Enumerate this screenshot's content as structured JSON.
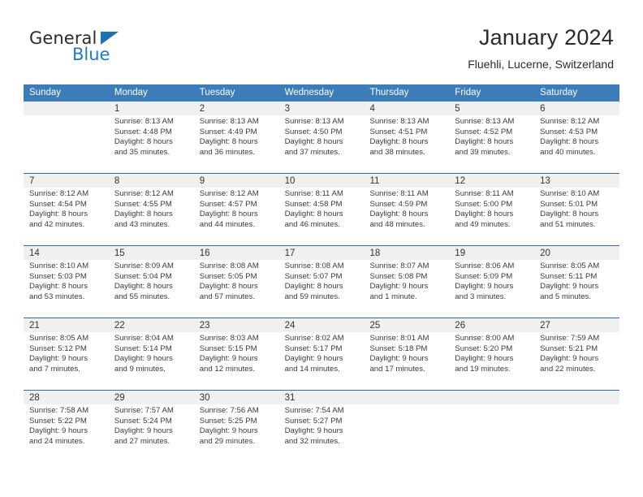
{
  "brand": {
    "name_top": "General",
    "name_bottom": "Blue",
    "color_text": "#2b2b2b",
    "color_blue": "#1e7bc4"
  },
  "header": {
    "title": "January 2024",
    "subtitle": "Fluehli, Lucerne, Switzerland"
  },
  "theme": {
    "header_blue": "#3b7cb9",
    "separator_blue": "#2b6da8",
    "daynum_band": "#f0f0f0"
  },
  "weekdays": [
    "Sunday",
    "Monday",
    "Tuesday",
    "Wednesday",
    "Thursday",
    "Friday",
    "Saturday"
  ],
  "weeks": [
    [
      {
        "day": ""
      },
      {
        "day": "1",
        "sunrise": "Sunrise: 8:13 AM",
        "sunset": "Sunset: 4:48 PM",
        "daylight1": "Daylight: 8 hours",
        "daylight2": "and 35 minutes."
      },
      {
        "day": "2",
        "sunrise": "Sunrise: 8:13 AM",
        "sunset": "Sunset: 4:49 PM",
        "daylight1": "Daylight: 8 hours",
        "daylight2": "and 36 minutes."
      },
      {
        "day": "3",
        "sunrise": "Sunrise: 8:13 AM",
        "sunset": "Sunset: 4:50 PM",
        "daylight1": "Daylight: 8 hours",
        "daylight2": "and 37 minutes."
      },
      {
        "day": "4",
        "sunrise": "Sunrise: 8:13 AM",
        "sunset": "Sunset: 4:51 PM",
        "daylight1": "Daylight: 8 hours",
        "daylight2": "and 38 minutes."
      },
      {
        "day": "5",
        "sunrise": "Sunrise: 8:13 AM",
        "sunset": "Sunset: 4:52 PM",
        "daylight1": "Daylight: 8 hours",
        "daylight2": "and 39 minutes."
      },
      {
        "day": "6",
        "sunrise": "Sunrise: 8:12 AM",
        "sunset": "Sunset: 4:53 PM",
        "daylight1": "Daylight: 8 hours",
        "daylight2": "and 40 minutes."
      }
    ],
    [
      {
        "day": "7",
        "sunrise": "Sunrise: 8:12 AM",
        "sunset": "Sunset: 4:54 PM",
        "daylight1": "Daylight: 8 hours",
        "daylight2": "and 42 minutes."
      },
      {
        "day": "8",
        "sunrise": "Sunrise: 8:12 AM",
        "sunset": "Sunset: 4:55 PM",
        "daylight1": "Daylight: 8 hours",
        "daylight2": "and 43 minutes."
      },
      {
        "day": "9",
        "sunrise": "Sunrise: 8:12 AM",
        "sunset": "Sunset: 4:57 PM",
        "daylight1": "Daylight: 8 hours",
        "daylight2": "and 44 minutes."
      },
      {
        "day": "10",
        "sunrise": "Sunrise: 8:11 AM",
        "sunset": "Sunset: 4:58 PM",
        "daylight1": "Daylight: 8 hours",
        "daylight2": "and 46 minutes."
      },
      {
        "day": "11",
        "sunrise": "Sunrise: 8:11 AM",
        "sunset": "Sunset: 4:59 PM",
        "daylight1": "Daylight: 8 hours",
        "daylight2": "and 48 minutes."
      },
      {
        "day": "12",
        "sunrise": "Sunrise: 8:11 AM",
        "sunset": "Sunset: 5:00 PM",
        "daylight1": "Daylight: 8 hours",
        "daylight2": "and 49 minutes."
      },
      {
        "day": "13",
        "sunrise": "Sunrise: 8:10 AM",
        "sunset": "Sunset: 5:01 PM",
        "daylight1": "Daylight: 8 hours",
        "daylight2": "and 51 minutes."
      }
    ],
    [
      {
        "day": "14",
        "sunrise": "Sunrise: 8:10 AM",
        "sunset": "Sunset: 5:03 PM",
        "daylight1": "Daylight: 8 hours",
        "daylight2": "and 53 minutes."
      },
      {
        "day": "15",
        "sunrise": "Sunrise: 8:09 AM",
        "sunset": "Sunset: 5:04 PM",
        "daylight1": "Daylight: 8 hours",
        "daylight2": "and 55 minutes."
      },
      {
        "day": "16",
        "sunrise": "Sunrise: 8:08 AM",
        "sunset": "Sunset: 5:05 PM",
        "daylight1": "Daylight: 8 hours",
        "daylight2": "and 57 minutes."
      },
      {
        "day": "17",
        "sunrise": "Sunrise: 8:08 AM",
        "sunset": "Sunset: 5:07 PM",
        "daylight1": "Daylight: 8 hours",
        "daylight2": "and 59 minutes."
      },
      {
        "day": "18",
        "sunrise": "Sunrise: 8:07 AM",
        "sunset": "Sunset: 5:08 PM",
        "daylight1": "Daylight: 9 hours",
        "daylight2": "and 1 minute."
      },
      {
        "day": "19",
        "sunrise": "Sunrise: 8:06 AM",
        "sunset": "Sunset: 5:09 PM",
        "daylight1": "Daylight: 9 hours",
        "daylight2": "and 3 minutes."
      },
      {
        "day": "20",
        "sunrise": "Sunrise: 8:05 AM",
        "sunset": "Sunset: 5:11 PM",
        "daylight1": "Daylight: 9 hours",
        "daylight2": "and 5 minutes."
      }
    ],
    [
      {
        "day": "21",
        "sunrise": "Sunrise: 8:05 AM",
        "sunset": "Sunset: 5:12 PM",
        "daylight1": "Daylight: 9 hours",
        "daylight2": "and 7 minutes."
      },
      {
        "day": "22",
        "sunrise": "Sunrise: 8:04 AM",
        "sunset": "Sunset: 5:14 PM",
        "daylight1": "Daylight: 9 hours",
        "daylight2": "and 9 minutes."
      },
      {
        "day": "23",
        "sunrise": "Sunrise: 8:03 AM",
        "sunset": "Sunset: 5:15 PM",
        "daylight1": "Daylight: 9 hours",
        "daylight2": "and 12 minutes."
      },
      {
        "day": "24",
        "sunrise": "Sunrise: 8:02 AM",
        "sunset": "Sunset: 5:17 PM",
        "daylight1": "Daylight: 9 hours",
        "daylight2": "and 14 minutes."
      },
      {
        "day": "25",
        "sunrise": "Sunrise: 8:01 AM",
        "sunset": "Sunset: 5:18 PM",
        "daylight1": "Daylight: 9 hours",
        "daylight2": "and 17 minutes."
      },
      {
        "day": "26",
        "sunrise": "Sunrise: 8:00 AM",
        "sunset": "Sunset: 5:20 PM",
        "daylight1": "Daylight: 9 hours",
        "daylight2": "and 19 minutes."
      },
      {
        "day": "27",
        "sunrise": "Sunrise: 7:59 AM",
        "sunset": "Sunset: 5:21 PM",
        "daylight1": "Daylight: 9 hours",
        "daylight2": "and 22 minutes."
      }
    ],
    [
      {
        "day": "28",
        "sunrise": "Sunrise: 7:58 AM",
        "sunset": "Sunset: 5:22 PM",
        "daylight1": "Daylight: 9 hours",
        "daylight2": "and 24 minutes."
      },
      {
        "day": "29",
        "sunrise": "Sunrise: 7:57 AM",
        "sunset": "Sunset: 5:24 PM",
        "daylight1": "Daylight: 9 hours",
        "daylight2": "and 27 minutes."
      },
      {
        "day": "30",
        "sunrise": "Sunrise: 7:56 AM",
        "sunset": "Sunset: 5:25 PM",
        "daylight1": "Daylight: 9 hours",
        "daylight2": "and 29 minutes."
      },
      {
        "day": "31",
        "sunrise": "Sunrise: 7:54 AM",
        "sunset": "Sunset: 5:27 PM",
        "daylight1": "Daylight: 9 hours",
        "daylight2": "and 32 minutes."
      },
      {
        "day": ""
      },
      {
        "day": ""
      },
      {
        "day": ""
      }
    ]
  ]
}
